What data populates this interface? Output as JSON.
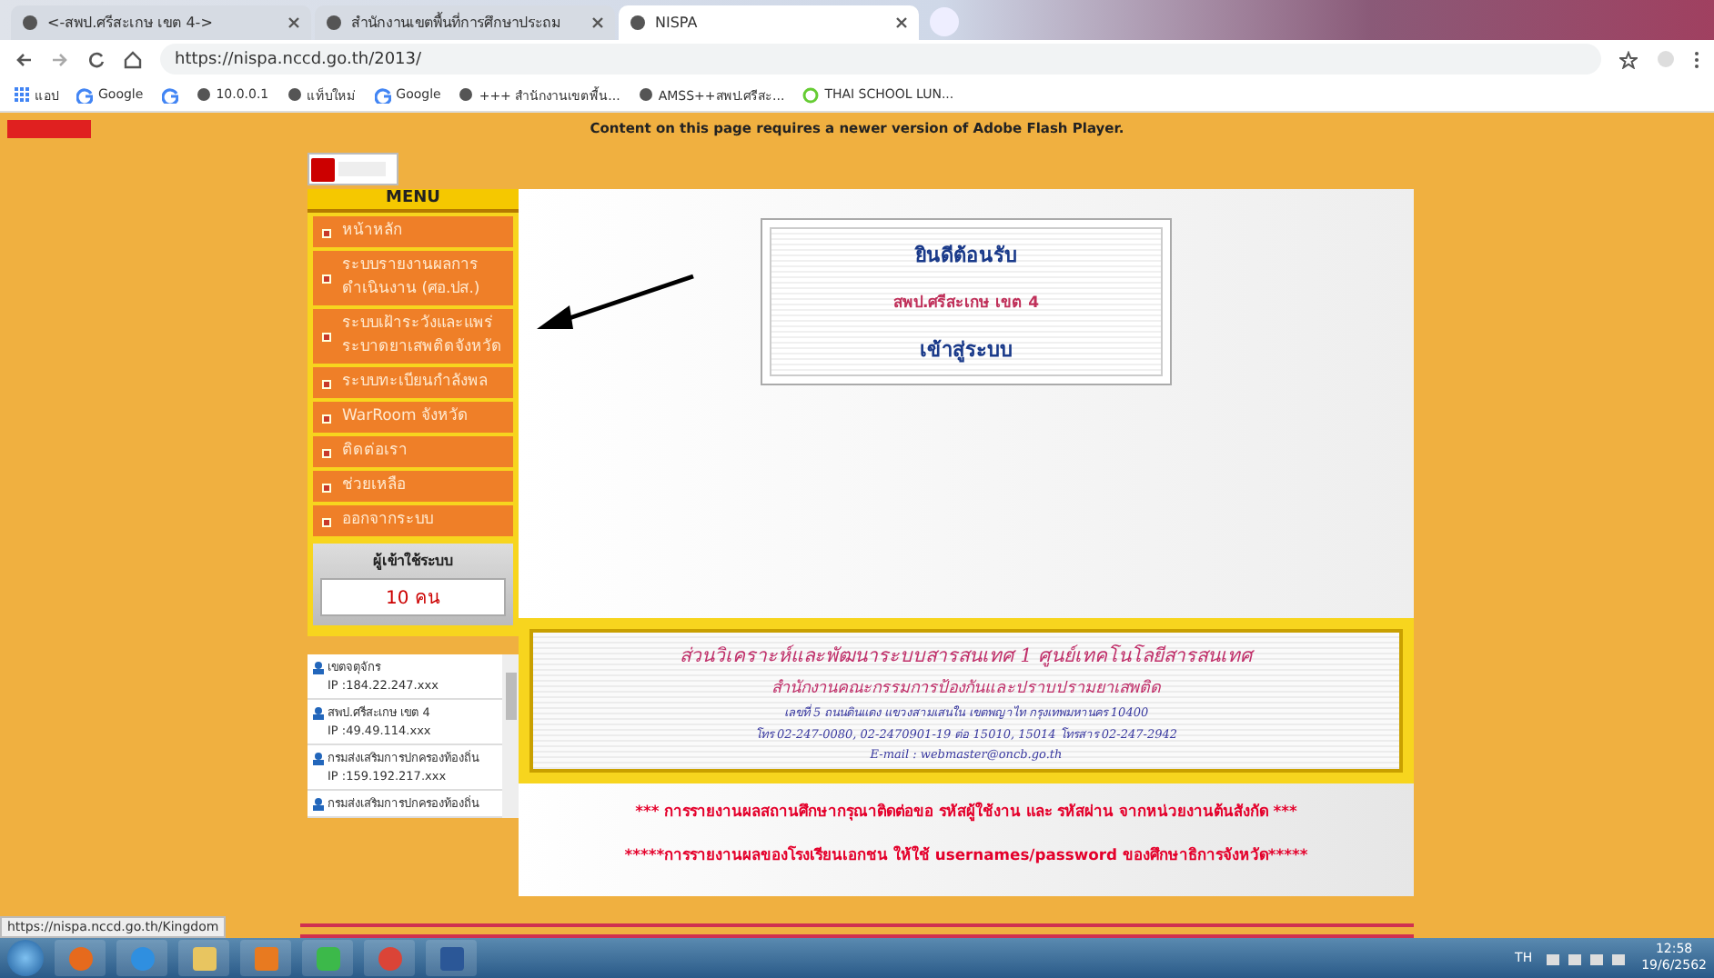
{
  "browser": {
    "tabs": [
      {
        "title": "<-สพป.ศรีสะเกษ เขต 4->",
        "selected": false
      },
      {
        "title": "สำนักงานเขตพื้นที่การศึกษาประถม",
        "selected": false
      },
      {
        "title": "NISPA",
        "selected": true
      }
    ],
    "url": "https://nispa.nccd.go.th/2013/",
    "bookmarks": [
      {
        "label": "แอป",
        "kind": "apps"
      },
      {
        "label": "Google",
        "kind": "google"
      },
      {
        "kind": "google"
      },
      {
        "label": "10.0.0.1",
        "kind": "globe"
      },
      {
        "label": "แท็บใหม่",
        "kind": "globe"
      },
      {
        "label": "Google",
        "kind": "google"
      },
      {
        "label": "+++ สำนักงานเขตพื้น...",
        "kind": "globe"
      },
      {
        "label": "AMSS++สพป.ศรีสะ...",
        "kind": "globe"
      },
      {
        "label": "THAI SCHOOL LUN...",
        "kind": "leaf"
      }
    ]
  },
  "page": {
    "flash_notice": "Content on this page requires a newer version of Adobe Flash Player.",
    "menu_title": "MENU",
    "menu": [
      "หน้าหลัก",
      "ระบบรายงานผลการดำเนินงาน (ศอ.ปส.)",
      "ระบบเฝ้าระวังและแพร่ระบาดยาเสพติดจังหวัด",
      "ระบบทะเบียนกำลังพล",
      "WarRoom จังหวัด",
      "ติดต่อเรา",
      "ช่วยเหลือ",
      "ออกจากระบบ"
    ],
    "online_title": "ผู้เข้าใช้ระบบ",
    "online_count": "10 คน",
    "online_users": [
      {
        "name": "เขตจตุจักร",
        "ip": "IP :184.22.247.xxx"
      },
      {
        "name": "สพป.ศรีสะเกษ เขต 4",
        "ip": "IP :49.49.114.xxx"
      },
      {
        "name": "กรมส่งเสริมการปกครองท้องถิ่น",
        "ip": "IP :159.192.217.xxx"
      },
      {
        "name": "กรมส่งเสริมการปกครองท้องถิ่น"
      }
    ],
    "welcome": [
      "ยินดีต้อนรับ",
      "สพป.ศรีสะเกษ เขต 4",
      "เข้าสู่ระบบ"
    ],
    "org_lines": [
      "ส่วนวิเคราะห์และพัฒนาระบบสารสนเทศ 1 ศูนย์เทคโนโลยีสารสนเทศ",
      "สำนักงานคณะกรรมการป้องกันและปราบปรามยาเสพติด",
      "เลขที่ 5 ถนนดินแดง แขวงสามเสนใน เขตพญาไท กรุงเทพมหานคร 10400",
      "โทร 02-247-0080, 02-2470901-19 ต่อ 15010, 15014   โทรสาร 02-247-2942",
      "E-mail : webmaster@oncb.go.th"
    ],
    "notices": [
      "*** การรายงานผลสถานศึกษากรุณาติดต่อขอ รหัสผู้ใช้งาน และ รหัสผ่าน จากหน่วยงานต้นสังกัด ***",
      "*****การรายงานผลของโรงเรียนเอกชน ให้ใช้ usernames/password ของศึกษาธิการจังหวัด*****"
    ]
  },
  "status_url": "https://nispa.nccd.go.th/Kingdom",
  "taskbar": {
    "apps": [
      {
        "kind": "firefox"
      },
      {
        "kind": "ie"
      },
      {
        "kind": "folder"
      },
      {
        "kind": "media"
      },
      {
        "kind": "line"
      },
      {
        "kind": "chrome"
      },
      {
        "kind": "word"
      }
    ],
    "language": "TH",
    "time": "12:58",
    "date": "19/6/2562"
  }
}
